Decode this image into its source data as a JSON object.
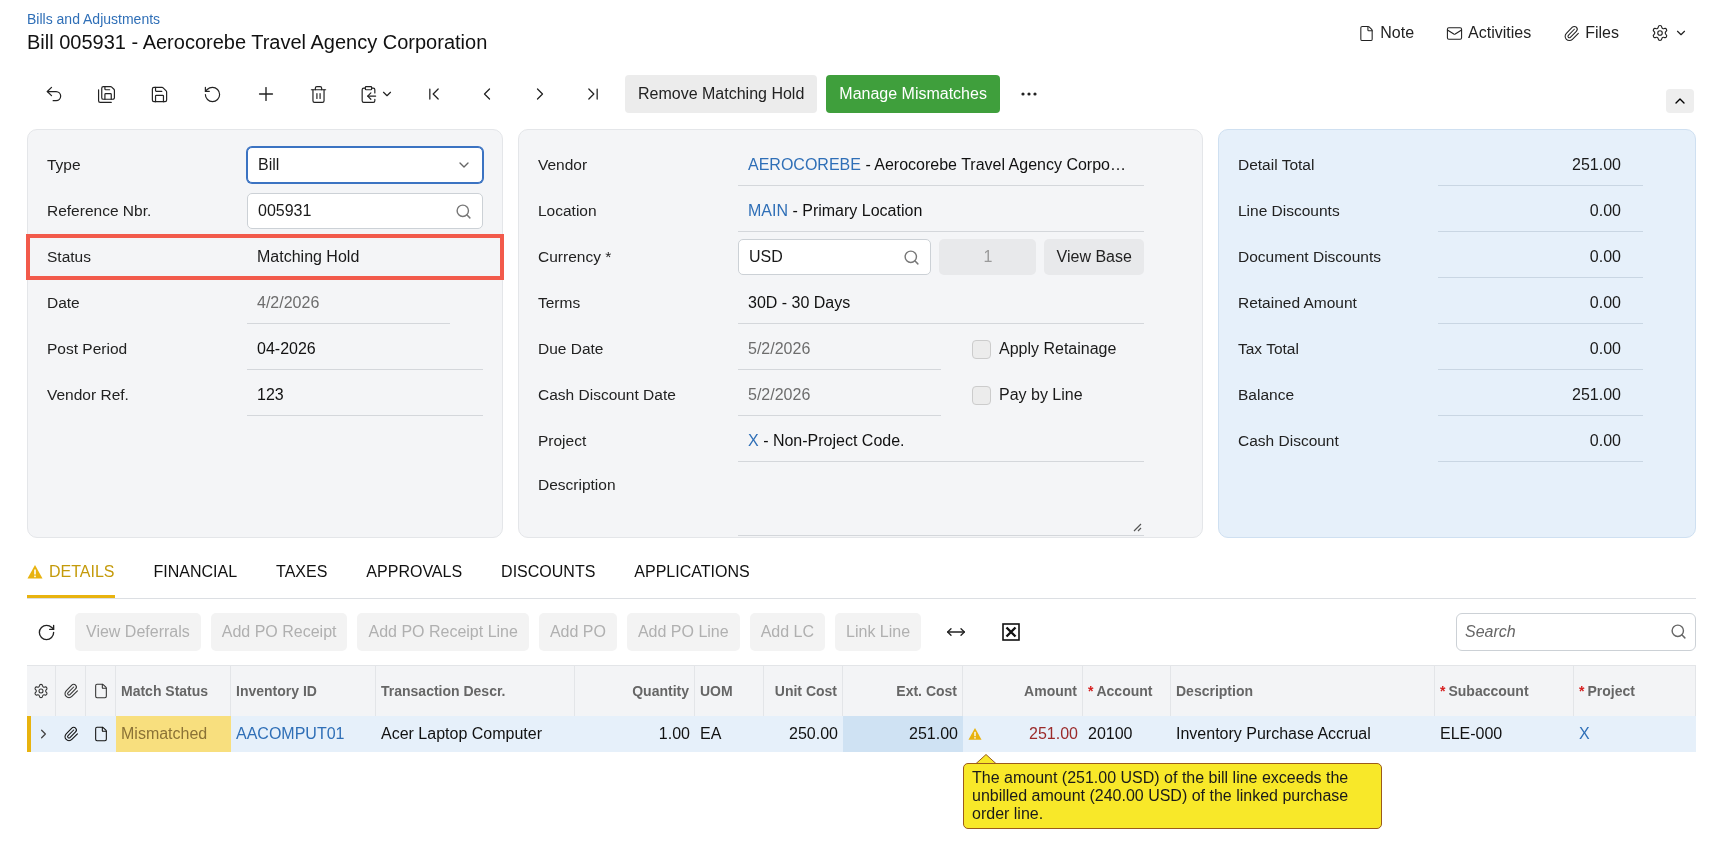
{
  "breadcrumb": "Bills and Adjustments",
  "title": "Bill 005931 - Aerocorebe Travel Agency Corporation",
  "header_actions": [
    {
      "kind": "note",
      "label": "Note"
    },
    {
      "kind": "activities",
      "label": "Activities"
    },
    {
      "kind": "files",
      "label": "Files"
    }
  ],
  "toolbar": {
    "actions": [
      {
        "kind": "secondary",
        "label": "Remove Matching Hold"
      },
      {
        "kind": "primary",
        "label": "Manage Mismatches"
      }
    ]
  },
  "document_form": {
    "fields": [
      {
        "kind": "select",
        "label": "Type",
        "value": "Bill",
        "highlighted": false
      },
      {
        "kind": "lookup",
        "label": "Reference Nbr.",
        "value": "005931",
        "highlighted": false
      },
      {
        "kind": "plain",
        "label": "Status",
        "value": "Matching Hold",
        "highlighted": true
      },
      {
        "kind": "disabled",
        "label": "Date",
        "value": "4/2/2026",
        "highlighted": false
      },
      {
        "kind": "text",
        "label": "Post Period",
        "value": "04-2026",
        "highlighted": false
      },
      {
        "kind": "text",
        "label": "Vendor Ref.",
        "value": "123",
        "highlighted": false
      }
    ]
  },
  "vendor_form": {
    "fields": [
      {
        "kind": "link_text",
        "label": "Vendor",
        "link": "AEROCOREBE",
        "value": "- Aerocorebe Travel Agency Corpo…"
      },
      {
        "kind": "link_text",
        "label": "Location",
        "link": "MAIN",
        "value": "- Primary Location"
      },
      {
        "kind": "currency",
        "label": "Currency *",
        "value": "USD",
        "rate": "1",
        "button": "View Base"
      },
      {
        "kind": "text",
        "label": "Terms",
        "value": "30D - 30 Days"
      },
      {
        "kind": "date_check",
        "label": "Due Date",
        "value": "5/2/2026",
        "checkbox": {
          "label": "Apply Retainage",
          "checked": false
        }
      },
      {
        "kind": "date_check",
        "label": "Cash Discount Date",
        "value": "5/2/2026",
        "checkbox": {
          "label": "Pay by Line",
          "checked": false
        }
      },
      {
        "kind": "link_text",
        "label": "Project",
        "link": "X",
        "value": "- Non-Project Code."
      },
      {
        "kind": "textarea",
        "label": "Description"
      }
    ]
  },
  "totals": {
    "rows": [
      {
        "label": "Detail Total",
        "value": "251.00"
      },
      {
        "label": "Line Discounts",
        "value": "0.00"
      },
      {
        "label": "Document Discounts",
        "value": "0.00"
      },
      {
        "label": "Retained Amount",
        "value": "0.00"
      },
      {
        "label": "Tax Total",
        "value": "0.00"
      },
      {
        "label": "Balance",
        "value": "251.00"
      },
      {
        "label": "Cash Discount",
        "value": "0.00"
      }
    ]
  },
  "tabs": [
    {
      "label": "DETAILS",
      "selected": true,
      "warning": true
    },
    {
      "label": "FINANCIAL",
      "selected": false,
      "warning": false
    },
    {
      "label": "TAXES",
      "selected": false,
      "warning": false
    },
    {
      "label": "APPROVALS",
      "selected": false,
      "warning": false
    },
    {
      "label": "DISCOUNTS",
      "selected": false,
      "warning": false
    },
    {
      "label": "APPLICATIONS",
      "selected": false,
      "warning": false
    }
  ],
  "grid_toolbar": {
    "buttons": [
      {
        "label": "View Deferrals",
        "disabled": true
      },
      {
        "label": "Add PO Receipt",
        "disabled": true
      },
      {
        "label": "Add PO Receipt Line",
        "disabled": true
      },
      {
        "label": "Add PO",
        "disabled": true
      },
      {
        "label": "Add PO Line",
        "disabled": true
      },
      {
        "label": "Add LC",
        "disabled": true
      },
      {
        "label": "Link Line",
        "disabled": true
      }
    ],
    "search": {
      "placeholder": "Search"
    }
  },
  "table": {
    "columns": [
      {
        "label": "Match Status",
        "kind": "text"
      },
      {
        "label": "Inventory ID",
        "kind": "text"
      },
      {
        "label": "Transaction Descr.",
        "kind": "text"
      },
      {
        "label": "Quantity",
        "kind": "number"
      },
      {
        "label": "UOM",
        "kind": "text"
      },
      {
        "label": "Unit Cost",
        "kind": "number"
      },
      {
        "label": "Ext. Cost",
        "kind": "number"
      },
      {
        "label": "Amount",
        "kind": "number"
      },
      {
        "label": "Account",
        "kind": "text",
        "required_mark": "*"
      },
      {
        "label": "Description",
        "kind": "text"
      },
      {
        "label": "Subaccount",
        "kind": "text",
        "required_mark": "*"
      },
      {
        "label": "Project",
        "kind": "text",
        "required_mark": "*"
      }
    ],
    "rows": [
      {
        "selected": true,
        "cells": [
          {
            "kind": "status",
            "text": "Mismatched"
          },
          {
            "kind": "link",
            "text": "AACOMPUT01"
          },
          {
            "kind": "text",
            "text": "Acer Laptop Computer"
          },
          {
            "kind": "text",
            "text": "1.00"
          },
          {
            "kind": "text",
            "text": "EA"
          },
          {
            "kind": "text",
            "text": "250.00"
          },
          {
            "kind": "active",
            "text": "251.00"
          },
          {
            "kind": "error",
            "text": "251.00"
          },
          {
            "kind": "text",
            "text": "20100"
          },
          {
            "kind": "text",
            "text": "Inventory Purchase Accrual"
          },
          {
            "kind": "text",
            "text": "ELE-000"
          },
          {
            "kind": "link",
            "text": "X"
          }
        ]
      }
    ]
  },
  "tooltip": "The amount (251.00 USD) of the bill line exceeds the unbilled amount (240.00 USD) of the linked purchase order line."
}
